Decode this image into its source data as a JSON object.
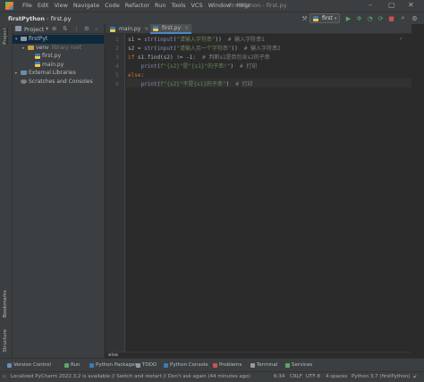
{
  "menu": {
    "items": [
      "File",
      "Edit",
      "View",
      "Navigate",
      "Code",
      "Refactor",
      "Run",
      "Tools",
      "VCS",
      "Window",
      "Help"
    ],
    "window_title": "firstPython - first.py"
  },
  "navbar": {
    "project": "firstPython",
    "file": "first.py",
    "run_config": "first"
  },
  "left_strip": {
    "project": "Project",
    "bookmarks": "Bookmarks",
    "structure": "Structure"
  },
  "project_panel": {
    "title": "Project",
    "tree": [
      {
        "label": "firstPyt",
        "indent": 0,
        "arrow": "▾",
        "icon": "folder"
      },
      {
        "label": "venv",
        "indent": 1,
        "arrow": "▸",
        "icon": "folder-orange",
        "suffix": "library root"
      },
      {
        "label": "first.py",
        "indent": 2,
        "arrow": "",
        "icon": "py"
      },
      {
        "label": "main.py",
        "indent": 2,
        "arrow": "",
        "icon": "py"
      },
      {
        "label": "External Libraries",
        "indent": 0,
        "arrow": "▸",
        "icon": "lib"
      },
      {
        "label": "Scratches and Consoles",
        "indent": 0,
        "arrow": "",
        "icon": "scratch"
      }
    ]
  },
  "tabs": [
    {
      "label": "main.py",
      "active": false
    },
    {
      "label": "first.py",
      "active": true
    }
  ],
  "editor": {
    "line_numbers": [
      "1",
      "2",
      "3",
      "4",
      "5",
      "6"
    ],
    "lines": [
      [
        [
          "s1 = ",
          ""
        ],
        [
          "str",
          "bi"
        ],
        [
          "(",
          ""
        ],
        [
          "input",
          "bi"
        ],
        [
          "(",
          ""
        ],
        [
          "\"请输入字符串\"",
          "st"
        ],
        [
          "))  ",
          ""
        ],
        [
          "# 输入字符串1",
          "cm"
        ]
      ],
      [
        [
          "s2 = ",
          ""
        ],
        [
          "str",
          "bi"
        ],
        [
          "(",
          ""
        ],
        [
          "input",
          "bi"
        ],
        [
          "(",
          ""
        ],
        [
          "\"请输入另一个字符串\"",
          "st"
        ],
        [
          "))  ",
          ""
        ],
        [
          "# 输入字符串2",
          "cm"
        ]
      ],
      [
        [
          "if ",
          "kw"
        ],
        [
          "s1.find(s2) != -1:  ",
          ""
        ],
        [
          "# 判断s1是否包含s2的子串",
          "cm"
        ]
      ],
      [
        [
          "    ",
          ""
        ],
        [
          "print",
          "bi"
        ],
        [
          "(",
          ""
        ],
        [
          "f\"{s2}\"是\"{s1}\"的子串!\"",
          "st"
        ],
        [
          ")  ",
          ""
        ],
        [
          "# 打印",
          "cm"
        ]
      ],
      [
        [
          "else",
          "kw"
        ],
        [
          ":",
          ""
        ]
      ],
      [
        [
          "    ",
          ""
        ],
        [
          "print",
          "bi"
        ],
        [
          "(",
          ""
        ],
        [
          "f\"{s2}\"不是{s1}的子串\"",
          "st"
        ],
        [
          ")  ",
          ""
        ],
        [
          "# 打印",
          "cm"
        ]
      ]
    ],
    "breadcrumb": "else"
  },
  "toolwindows": [
    "Version Control",
    "Run",
    "Python Packages",
    "TODO",
    "Python Console",
    "Problems",
    "Terminal",
    "Services"
  ],
  "status": {
    "message": "Localized PyCharm 2022.3.2 is available // Switch and restart // Don't ask again (44 minutes ago)",
    "position": "6:34",
    "line_sep": "CRLF",
    "encoding": "UTF-8",
    "indent": "4 spaces",
    "interpreter": "Python 3.7 (firstPython)"
  }
}
